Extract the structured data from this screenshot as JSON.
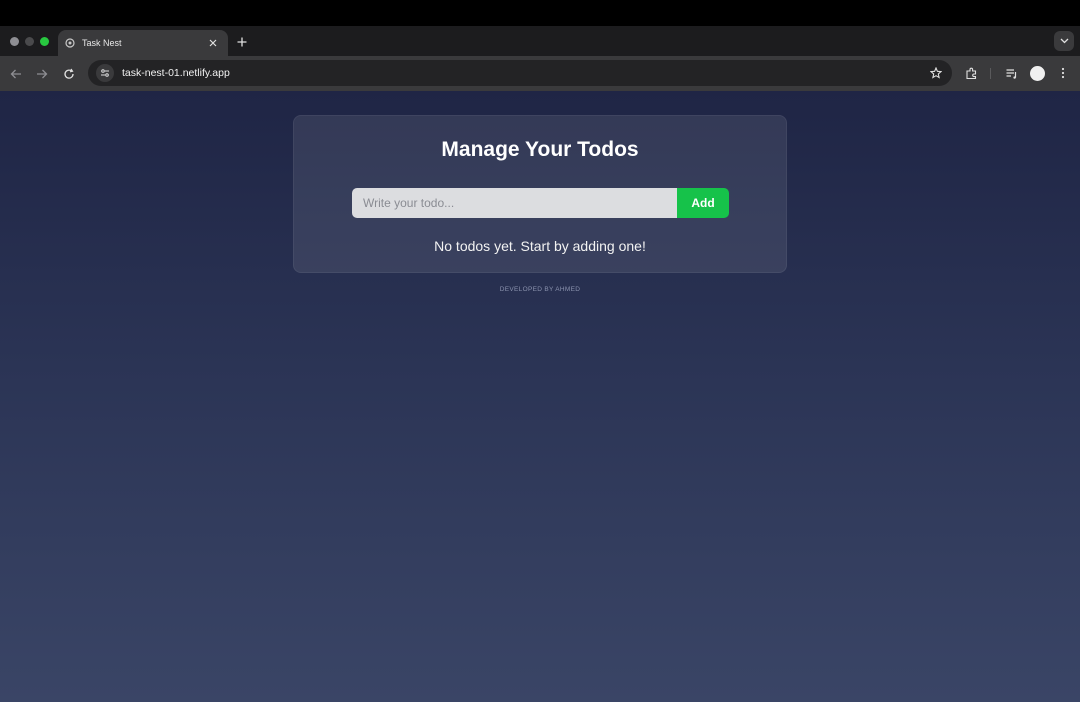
{
  "browser": {
    "tab": {
      "title": "Task Nest"
    },
    "address_bar": {
      "url": "task-nest-01.netlify.app"
    }
  },
  "app": {
    "title": "Manage Your Todos",
    "input": {
      "placeholder": "Write your todo...",
      "value": ""
    },
    "add_label": "Add",
    "empty_message": "No todos yet. Start by adding one!",
    "footer": "DEVELOPED BY AHMED"
  },
  "colors": {
    "accent_green": "#16c24a",
    "background_top": "#1f2545",
    "background_bottom": "#3a4566"
  }
}
